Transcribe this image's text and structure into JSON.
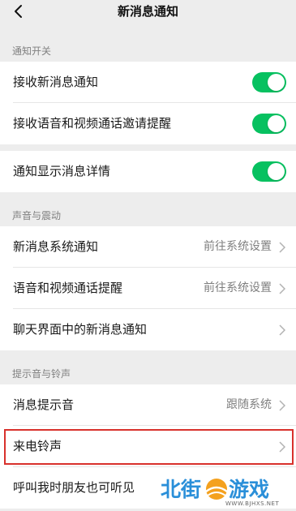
{
  "header": {
    "title": "新消息通知"
  },
  "sections": {
    "notify_switch": "通知开关",
    "sound_vibration": "声音与震动",
    "tone_ringtone": "提示音与铃声"
  },
  "rows": {
    "receive_new": {
      "label": "接收新消息通知",
      "toggle_on": true
    },
    "receive_call_invite": {
      "label": "接收语音和视频通话邀请提醒",
      "toggle_on": true
    },
    "show_details": {
      "label": "通知显示消息详情",
      "toggle_on": true
    },
    "system_notify": {
      "label": "新消息系统通知",
      "value": "前往系统设置"
    },
    "call_alert": {
      "label": "语音和视频通话提醒",
      "value": "前往系统设置"
    },
    "chat_notify": {
      "label": "聊天界面中的新消息通知"
    },
    "msg_tone": {
      "label": "消息提示音",
      "value": "跟随系统"
    },
    "ringtone": {
      "label": "来电铃声"
    },
    "friend_hear": {
      "label": "呼叫我时朋友也可听见"
    }
  },
  "watermark": {
    "brand_left": "北街",
    "brand_right": "游戏",
    "url": "WWW.BJHXS.NET"
  },
  "colors": {
    "toggle_on": "#07c160",
    "highlight": "#d8312c",
    "background": "#ededed"
  },
  "icons": {
    "back": "back-arrow-icon",
    "chevron": "chevron-right-icon"
  }
}
